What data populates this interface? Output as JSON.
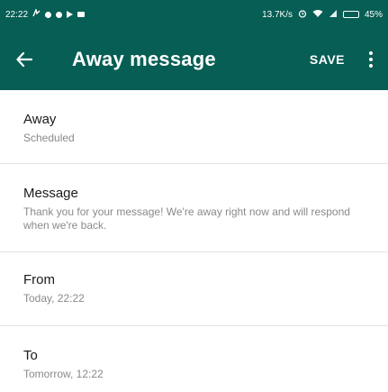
{
  "status_bar": {
    "time": "22:22",
    "network_speed": "13.7K/s",
    "battery": "45%",
    "battery_level": 0.45
  },
  "app_bar": {
    "title": "Away message",
    "save_label": "SAVE",
    "color": "#075e54"
  },
  "settings": [
    {
      "label": "Away",
      "value": "Scheduled"
    },
    {
      "label": "Message",
      "value": "Thank you for your message! We're away right now and will respond when we're back."
    },
    {
      "label": "From",
      "value": "Today, 22:22"
    },
    {
      "label": "To",
      "value": "Tomorrow, 12:22"
    }
  ]
}
